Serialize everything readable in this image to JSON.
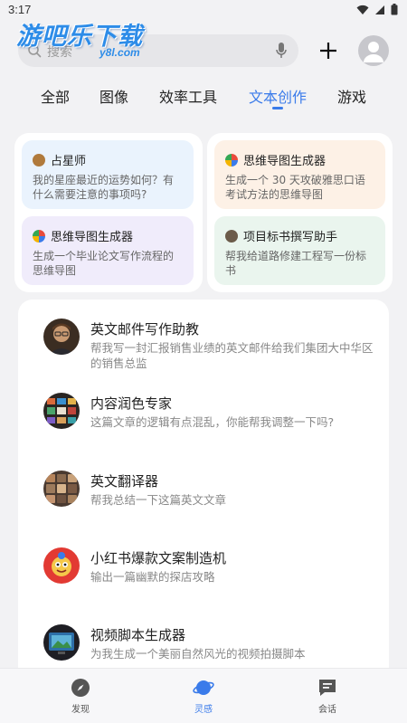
{
  "status_bar": {
    "time": "3:17"
  },
  "watermark": {
    "text": "游吧乐下载",
    "sub": "y8l.com"
  },
  "search": {
    "placeholder": "搜索"
  },
  "colors": {
    "accent": "#3a7bea",
    "card_blue": "#eaf3fd",
    "card_orange": "#fdf1e6",
    "card_purple": "#f0ecfb",
    "card_green": "#eaf5ee"
  },
  "tabs": [
    {
      "label": "全部"
    },
    {
      "label": "图像"
    },
    {
      "label": "效率工具"
    },
    {
      "label": "文本创作",
      "active": true
    },
    {
      "label": "游戏"
    }
  ],
  "suggestion_groups": [
    {
      "cards": [
        {
          "title": "占星师",
          "desc": "我的星座最近的运势如何？有什么需要注意的事项吗?",
          "icon": "astrologer-avatar"
        },
        {
          "title": "思维导图生成器",
          "desc": "生成一个毕业论文写作流程的思维导图",
          "icon": "mindmap-avatar"
        }
      ]
    },
    {
      "cards": [
        {
          "title": "思维导图生成器",
          "desc": "生成一个 30 天攻破雅思口语考试方法的思维导图",
          "icon": "mindmap-avatar"
        },
        {
          "title": "项目标书撰写助手",
          "desc": "帮我给道路修建工程写一份标书",
          "icon": "bid-writer-avatar"
        }
      ]
    }
  ],
  "assistants": [
    {
      "title": "英文邮件写作助教",
      "desc": "帮我写一封汇报销售业绩的英文邮件给我们集团大中华区的销售总监",
      "icon": "portrait-avatar"
    },
    {
      "title": "内容润色专家",
      "desc": "这篇文章的逻辑有点混乱，你能帮我调整一下吗?",
      "icon": "screens-avatar"
    },
    {
      "title": "英文翻译器",
      "desc": "帮我总结一下这篇英文文章",
      "icon": "grid-avatar"
    },
    {
      "title": "小红书爆款文案制造机",
      "desc": "输出一篇幽默的探店攻略",
      "icon": "mascot-avatar"
    },
    {
      "title": "视频脚本生成器",
      "desc": "为我生成一个美丽自然风光的视频拍摄脚本",
      "icon": "tv-avatar"
    }
  ],
  "bottom_nav": [
    {
      "label": "发现",
      "icon": "compass-icon"
    },
    {
      "label": "灵感",
      "icon": "planet-icon",
      "active": true
    },
    {
      "label": "会话",
      "icon": "chat-icon"
    }
  ]
}
